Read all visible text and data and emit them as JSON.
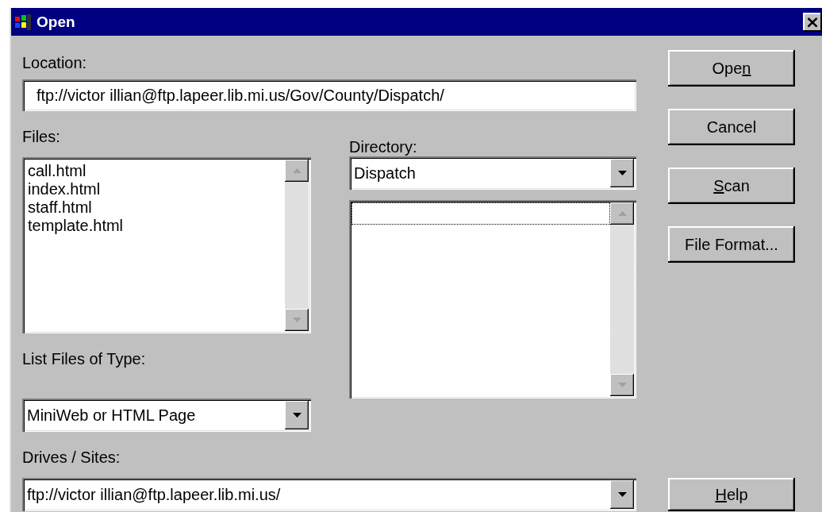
{
  "window": {
    "title": "Open",
    "close_label": "×"
  },
  "location": {
    "label": "Location:",
    "value": "ftp://victor illian@ftp.lapeer.lib.mi.us/Gov/County/Dispatch/"
  },
  "files": {
    "label": "Files:",
    "items": [
      {
        "name": "call.html",
        "selected": false
      },
      {
        "name": "index.html",
        "selected": false
      },
      {
        "name": "staff.html",
        "selected": false
      },
      {
        "name": "template.html",
        "selected": false
      }
    ]
  },
  "directory": {
    "label": "Directory:",
    "value": "Dispatch"
  },
  "file_type": {
    "label": "List Files of Type:",
    "value": "MiniWeb or HTML Page"
  },
  "drives": {
    "label": "Drives / Sites:",
    "value": "ftp://victor illian@ftp.lapeer.lib.mi.us/"
  },
  "buttons": [
    {
      "before": "Ope",
      "key": "n",
      "kind": "top"
    },
    {
      "before": "Cancel",
      "kind": "top"
    },
    {
      "key": "S",
      "after": "can",
      "kind": "top"
    },
    {
      "before": "File Format...",
      "kind": "top"
    },
    {
      "key": "H",
      "after": "elp",
      "kind": "bottom"
    }
  ]
}
